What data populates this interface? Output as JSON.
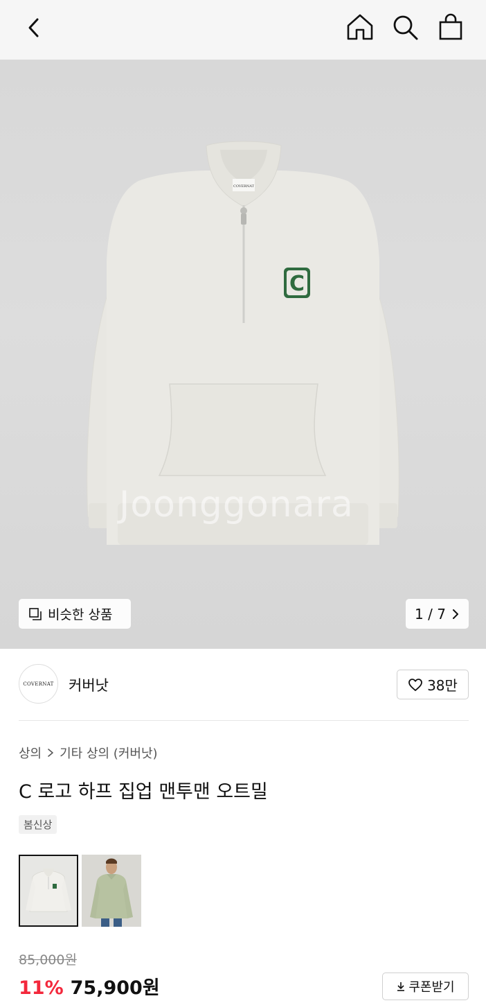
{
  "header": {
    "back_icon": "chevron-left-icon",
    "home_icon": "home-icon",
    "search_icon": "search-icon",
    "bag_icon": "shopping-bag-icon"
  },
  "gallery": {
    "watermark": "Joonggonara",
    "similar_label": "비슷한 상품",
    "counter": "1 / 7",
    "product_logo_letter": "C",
    "neck_label_text": "COVERNAT"
  },
  "brand": {
    "logo_text": "COVERNAT",
    "name": "커버낫",
    "like_count": "38만"
  },
  "product": {
    "breadcrumb": [
      "상의",
      "기타 상의 (커버낫)"
    ],
    "title": "C 로고 하프 집업 맨투맨 오트밀",
    "tag": "봄신상",
    "original_price": "85,000원",
    "discount": "11%",
    "price": "75,900원",
    "coupon_label": "쿠폰받기"
  },
  "colors": {
    "accent_red": "#f3283c",
    "logo_green": "#2f6b3f",
    "sweater": "#e9e8e3"
  }
}
